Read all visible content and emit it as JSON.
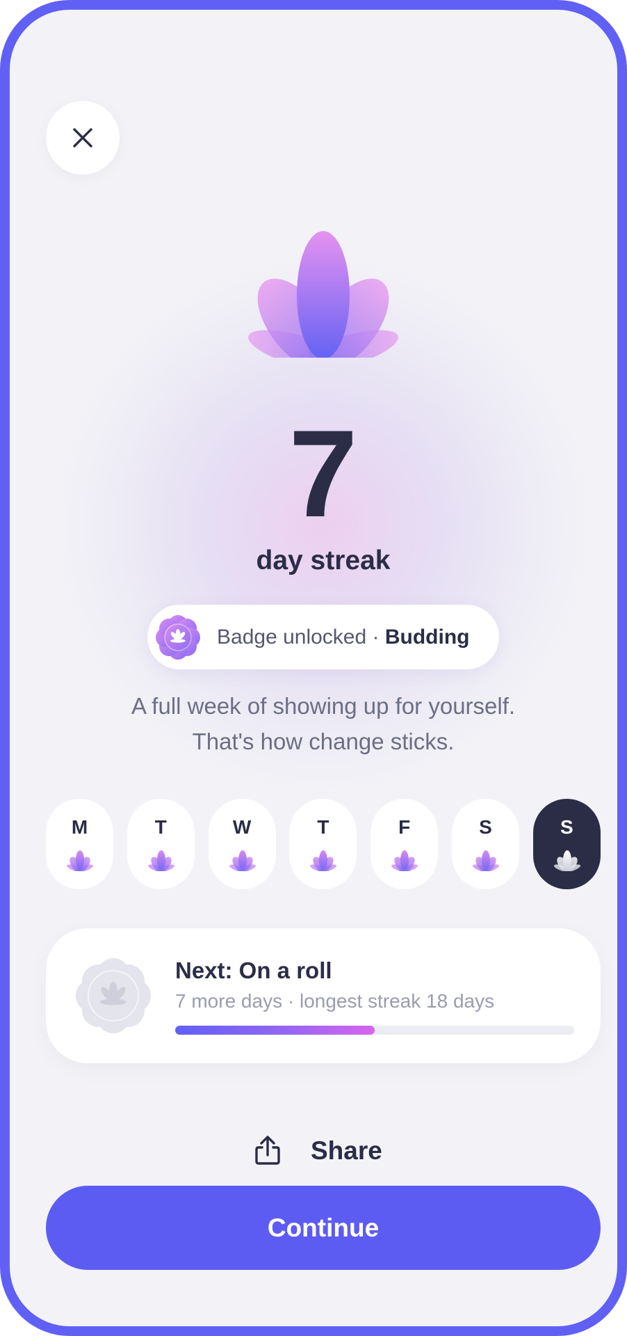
{
  "hero": {
    "streak_count": "7",
    "streak_label": "day streak"
  },
  "badge": {
    "prefix": "Badge unlocked · ",
    "name": "Budding"
  },
  "message": {
    "line1": "A full week of showing up for yourself.",
    "line2": "That's how change sticks."
  },
  "week": [
    {
      "letter": "M",
      "completed": true,
      "today": false
    },
    {
      "letter": "T",
      "completed": true,
      "today": false
    },
    {
      "letter": "W",
      "completed": true,
      "today": false
    },
    {
      "letter": "T",
      "completed": true,
      "today": false
    },
    {
      "letter": "F",
      "completed": true,
      "today": false
    },
    {
      "letter": "S",
      "completed": true,
      "today": false
    },
    {
      "letter": "S",
      "completed": true,
      "today": true
    }
  ],
  "next_badge": {
    "title": "Next: On a roll",
    "subtitle": "7 more days · longest streak 18 days",
    "progress": 0.5
  },
  "actions": {
    "share_label": "Share",
    "continue_label": "Continue"
  },
  "icons": {
    "close": "close-icon",
    "hero": "lotus-icon",
    "share": "share-icon"
  },
  "colors": {
    "accent": "#5d5cf2",
    "frame": "#6060f5",
    "text": "#2b2d47",
    "lotus_top": "#e08ef0",
    "lotus_bottom": "#6160f5"
  }
}
